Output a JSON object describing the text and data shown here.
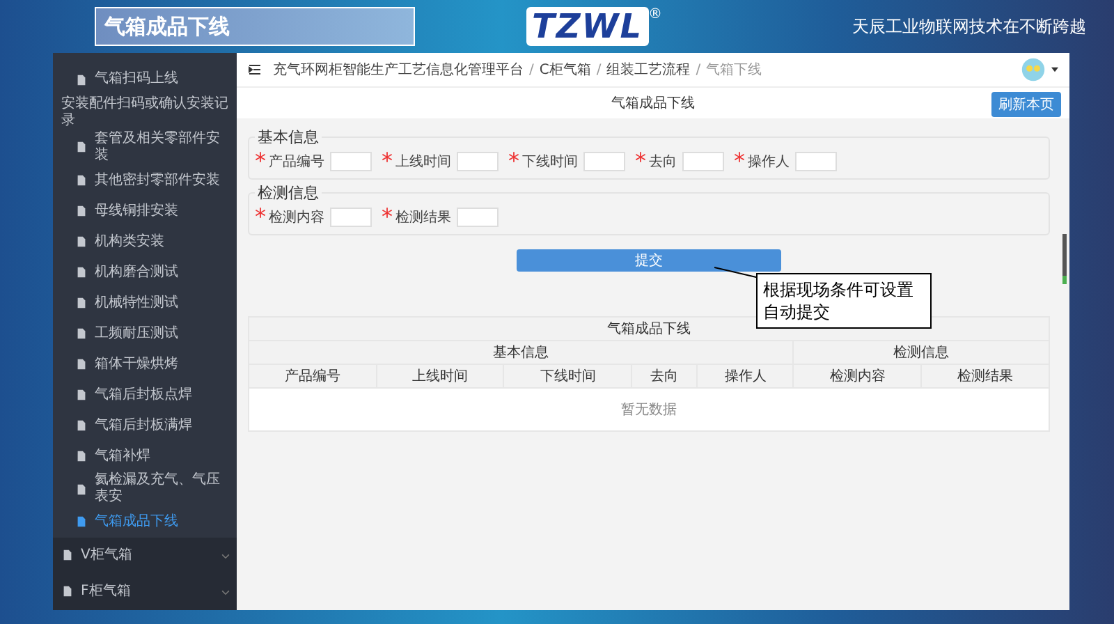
{
  "header": {
    "title": "气箱成品下线",
    "logo": {
      "text": "TZWL",
      "mark": "®"
    },
    "slogan": "天辰工业物联网技术在不断跨越"
  },
  "sidebar": {
    "items": [
      {
        "label": "气箱扫码上线",
        "kind": "page",
        "selected": false
      },
      {
        "label": "安装配件扫码或确认安装记录",
        "kind": "plain",
        "selected": false
      },
      {
        "label": "套管及相关零部件安装",
        "kind": "page",
        "selected": false
      },
      {
        "label": "其他密封零部件安装",
        "kind": "page",
        "selected": false
      },
      {
        "label": "母线铜排安装",
        "kind": "page",
        "selected": false
      },
      {
        "label": "机构类安装",
        "kind": "page",
        "selected": false
      },
      {
        "label": "机构磨合测试",
        "kind": "page",
        "selected": false
      },
      {
        "label": "机械特性测试",
        "kind": "page",
        "selected": false
      },
      {
        "label": "工频耐压测试",
        "kind": "page",
        "selected": false
      },
      {
        "label": "箱体干燥烘烤",
        "kind": "page",
        "selected": false
      },
      {
        "label": "气箱后封板点焊",
        "kind": "page",
        "selected": false
      },
      {
        "label": "气箱后封板满焊",
        "kind": "page",
        "selected": false
      },
      {
        "label": "气箱补焊",
        "kind": "page",
        "selected": false
      },
      {
        "label": "氦检漏及充气、气压表安",
        "kind": "page",
        "selected": false
      },
      {
        "label": "气箱成品下线",
        "kind": "page",
        "selected": true
      },
      {
        "label": "V柜气箱",
        "kind": "group",
        "selected": false,
        "expanded": false
      },
      {
        "label": "F柜气箱",
        "kind": "group",
        "selected": false,
        "expanded": false
      }
    ]
  },
  "breadcrumb_separator": "/",
  "required_mark": "*",
  "breadcrumb": [
    "充气环网柜智能生产工艺信息化管理平台",
    "C柜气箱",
    "组装工艺流程",
    "气箱下线"
  ],
  "page_title": "气箱成品下线",
  "refresh_button": "刷新本页",
  "form": {
    "sections": [
      {
        "legend": "基本信息",
        "fields": [
          {
            "label": "产品编号",
            "required": true
          },
          {
            "label": "上线时间",
            "required": true
          },
          {
            "label": "下线时间",
            "required": true
          },
          {
            "label": "去向",
            "required": true
          },
          {
            "label": "操作人",
            "required": true
          }
        ]
      },
      {
        "legend": "检测信息",
        "fields": [
          {
            "label": "检测内容",
            "required": true
          },
          {
            "label": "检测结果",
            "required": true
          }
        ]
      }
    ]
  },
  "submit_button": "提交",
  "callout": "根据现场条件可设置自动提交",
  "table": {
    "title": "气箱成品下线",
    "groups": [
      {
        "label": "基本信息",
        "columns": [
          "产品编号",
          "上线时间",
          "下线时间",
          "去向",
          "操作人"
        ]
      },
      {
        "label": "检测信息",
        "columns": [
          "检测内容",
          "检测结果"
        ]
      }
    ],
    "empty_text": "暂无数据"
  }
}
